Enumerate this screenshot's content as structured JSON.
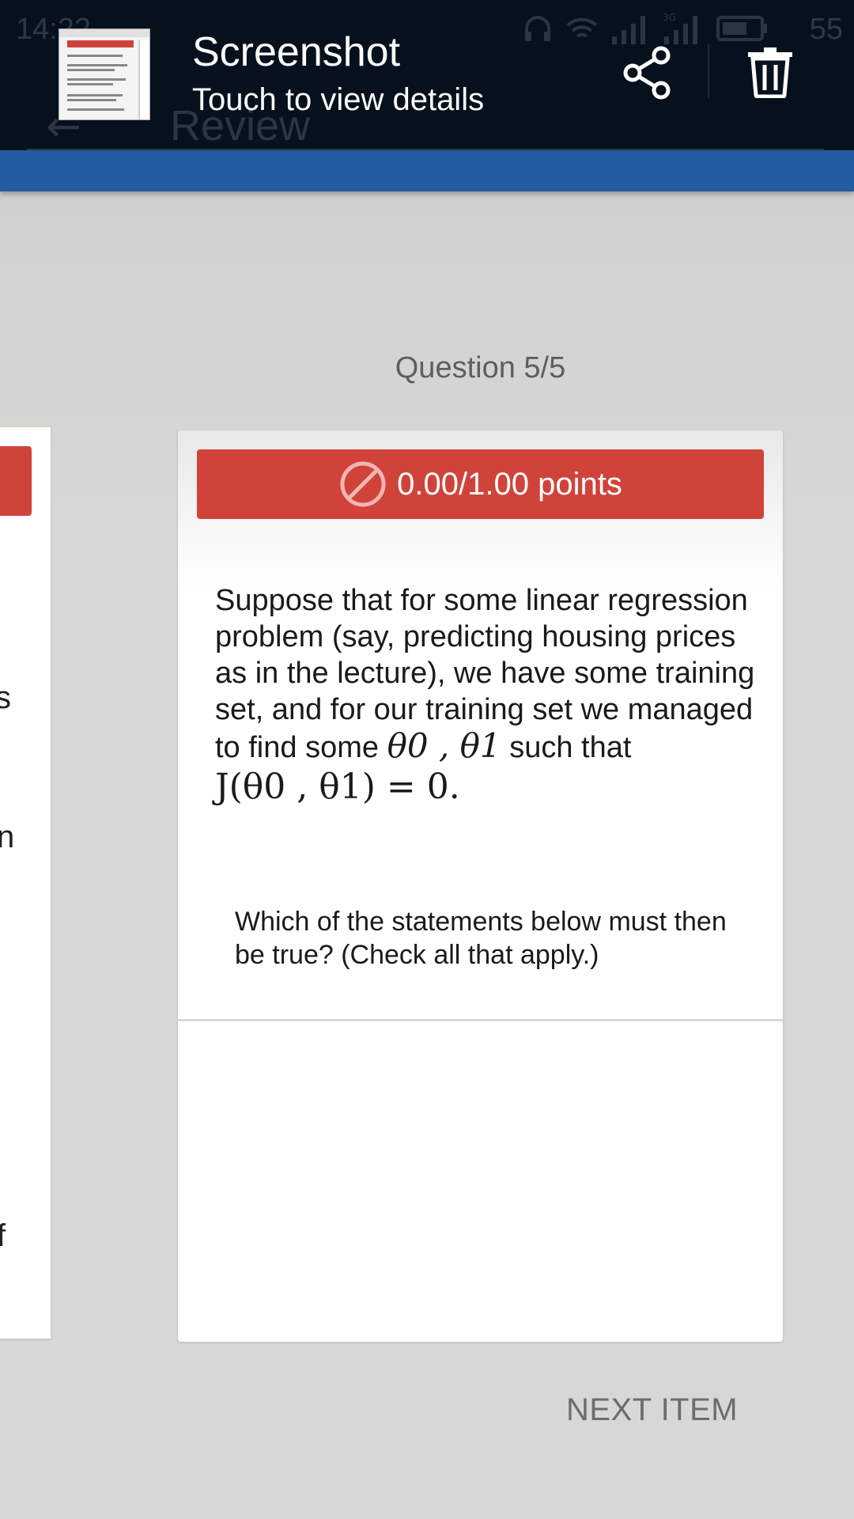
{
  "status_bar": {
    "time": "14:22",
    "battery_level": "55",
    "network_label": "3G"
  },
  "app_bar": {
    "title": "Review"
  },
  "notification": {
    "title": "Screenshot",
    "subtitle": "Touch to view details",
    "icons": [
      "screenshot-thumbnail",
      "share-icon",
      "trash-icon"
    ]
  },
  "quiz": {
    "question_counter": "Question 5/5",
    "score": "0.00/1.00 points",
    "score_icon": "no-entry-icon",
    "question_text": "Suppose that for some linear regression problem (say, predicting housing prices as in the lecture), we have some training set, and for our training set we managed to find some",
    "question_math_params": "θ0 , θ1",
    "question_suffix": "such that",
    "question_equation": "J(θ0 , θ1) = 0.",
    "prompt": "Which of the statements below must then be true? (Check all that apply.)"
  },
  "left_card_peek": {
    "chars": [
      "s",
      "n",
      "f"
    ]
  },
  "footer": {
    "next_label": "NEXT ITEM"
  },
  "colors": {
    "accent_red": "#d0433b",
    "app_bar_blue": "#225c9f",
    "notification_bg": "#06111d",
    "page_bg": "#d7d8d4"
  }
}
